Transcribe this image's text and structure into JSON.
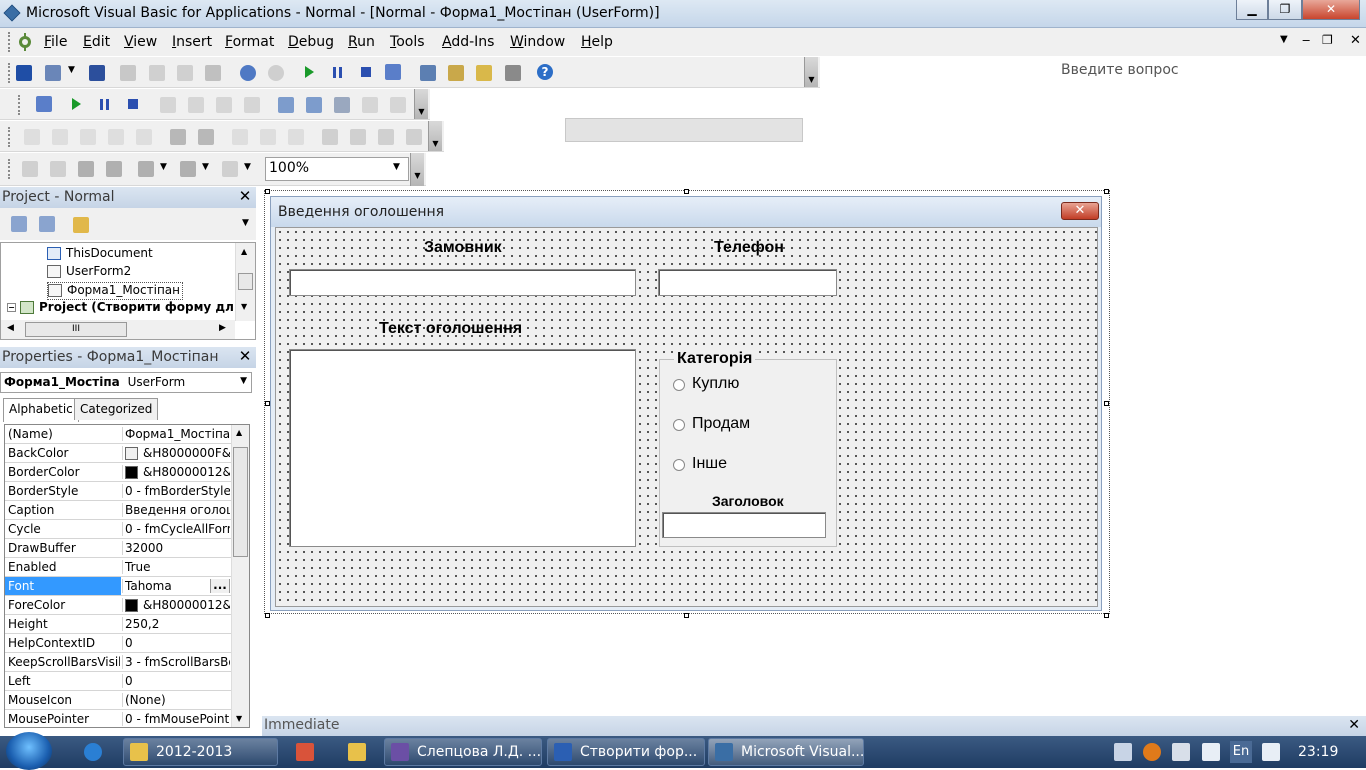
{
  "window": {
    "title": "Microsoft Visual Basic for Applications - Normal - [Normal - Форма1_Мостіпан (UserForm)]",
    "min_label": "▁",
    "max_label": "❐",
    "close_label": "✕"
  },
  "menu": {
    "items": [
      "File",
      "Edit",
      "View",
      "Insert",
      "Format",
      "Debug",
      "Run",
      "Tools",
      "Add-Ins",
      "Window",
      "Help"
    ],
    "help_placeholder": "Введите вопрос",
    "mdi_min": "‒",
    "mdi_restore": "❐",
    "mdi_close": "✕"
  },
  "toolbar": {
    "zoom_value": "100%"
  },
  "project": {
    "title": "Project - Normal",
    "close": "✕",
    "nodes": [
      {
        "label": "ThisDocument"
      },
      {
        "label": "UserForm2"
      },
      {
        "label": "Форма1_Мостіпан"
      },
      {
        "label": "Project (Створити форму дл"
      }
    ],
    "hscroll_thumb": "III"
  },
  "properties": {
    "title": "Properties - Форма1_Мостіпан",
    "close": "✕",
    "object_name": "Форма1_Мостіпа",
    "object_type": "UserForm",
    "tabs": [
      "Alphabetic",
      "Categorized"
    ],
    "rows": [
      {
        "name": "(Name)",
        "value": "Форма1_Мостіпан"
      },
      {
        "name": "BackColor",
        "value": "&H8000000F&",
        "swatch": "#f0f0f0"
      },
      {
        "name": "BorderColor",
        "value": "&H80000012&",
        "swatch": "#000000"
      },
      {
        "name": "BorderStyle",
        "value": "0 - fmBorderStyleN"
      },
      {
        "name": "Caption",
        "value": "Введення оголош"
      },
      {
        "name": "Cycle",
        "value": "0 - fmCycleAllForm"
      },
      {
        "name": "DrawBuffer",
        "value": "32000"
      },
      {
        "name": "Enabled",
        "value": "True"
      },
      {
        "name": "Font",
        "value": "Tahoma",
        "selected": true
      },
      {
        "name": "ForeColor",
        "value": "&H80000012&",
        "swatch": "#000000"
      },
      {
        "name": "Height",
        "value": "250,2"
      },
      {
        "name": "HelpContextID",
        "value": "0"
      },
      {
        "name": "KeepScrollBarsVisib",
        "value": "3 - fmScrollBarsBo"
      },
      {
        "name": "Left",
        "value": "0"
      },
      {
        "name": "MouseIcon",
        "value": "(None)"
      },
      {
        "name": "MousePointer",
        "value": "0 - fmMousePointe"
      }
    ],
    "ellipsis": "..."
  },
  "form": {
    "caption": "Введення оголошення",
    "close": "✕",
    "label_customer": "Замовник",
    "label_phone": "Телефон",
    "label_text": "Текст оголошення",
    "frame_caption": "Категорія",
    "options": [
      "Куплю",
      "Продам",
      "Інше"
    ],
    "label_heading": "Заголовок"
  },
  "immediate": {
    "title": "Immediate",
    "close": "✕"
  },
  "taskbar": {
    "buttons": [
      {
        "label": "2012-2013",
        "color": "#e8c14a"
      },
      {
        "label": "Слепцова Л.Д. ...",
        "color": "#6b4fa5"
      },
      {
        "label": "Створити фор...",
        "color": "#2b5fb3"
      },
      {
        "label": "Microsoft Visual...",
        "color": "#3a6ea5"
      }
    ],
    "lang": "En",
    "clock": "23:19"
  }
}
